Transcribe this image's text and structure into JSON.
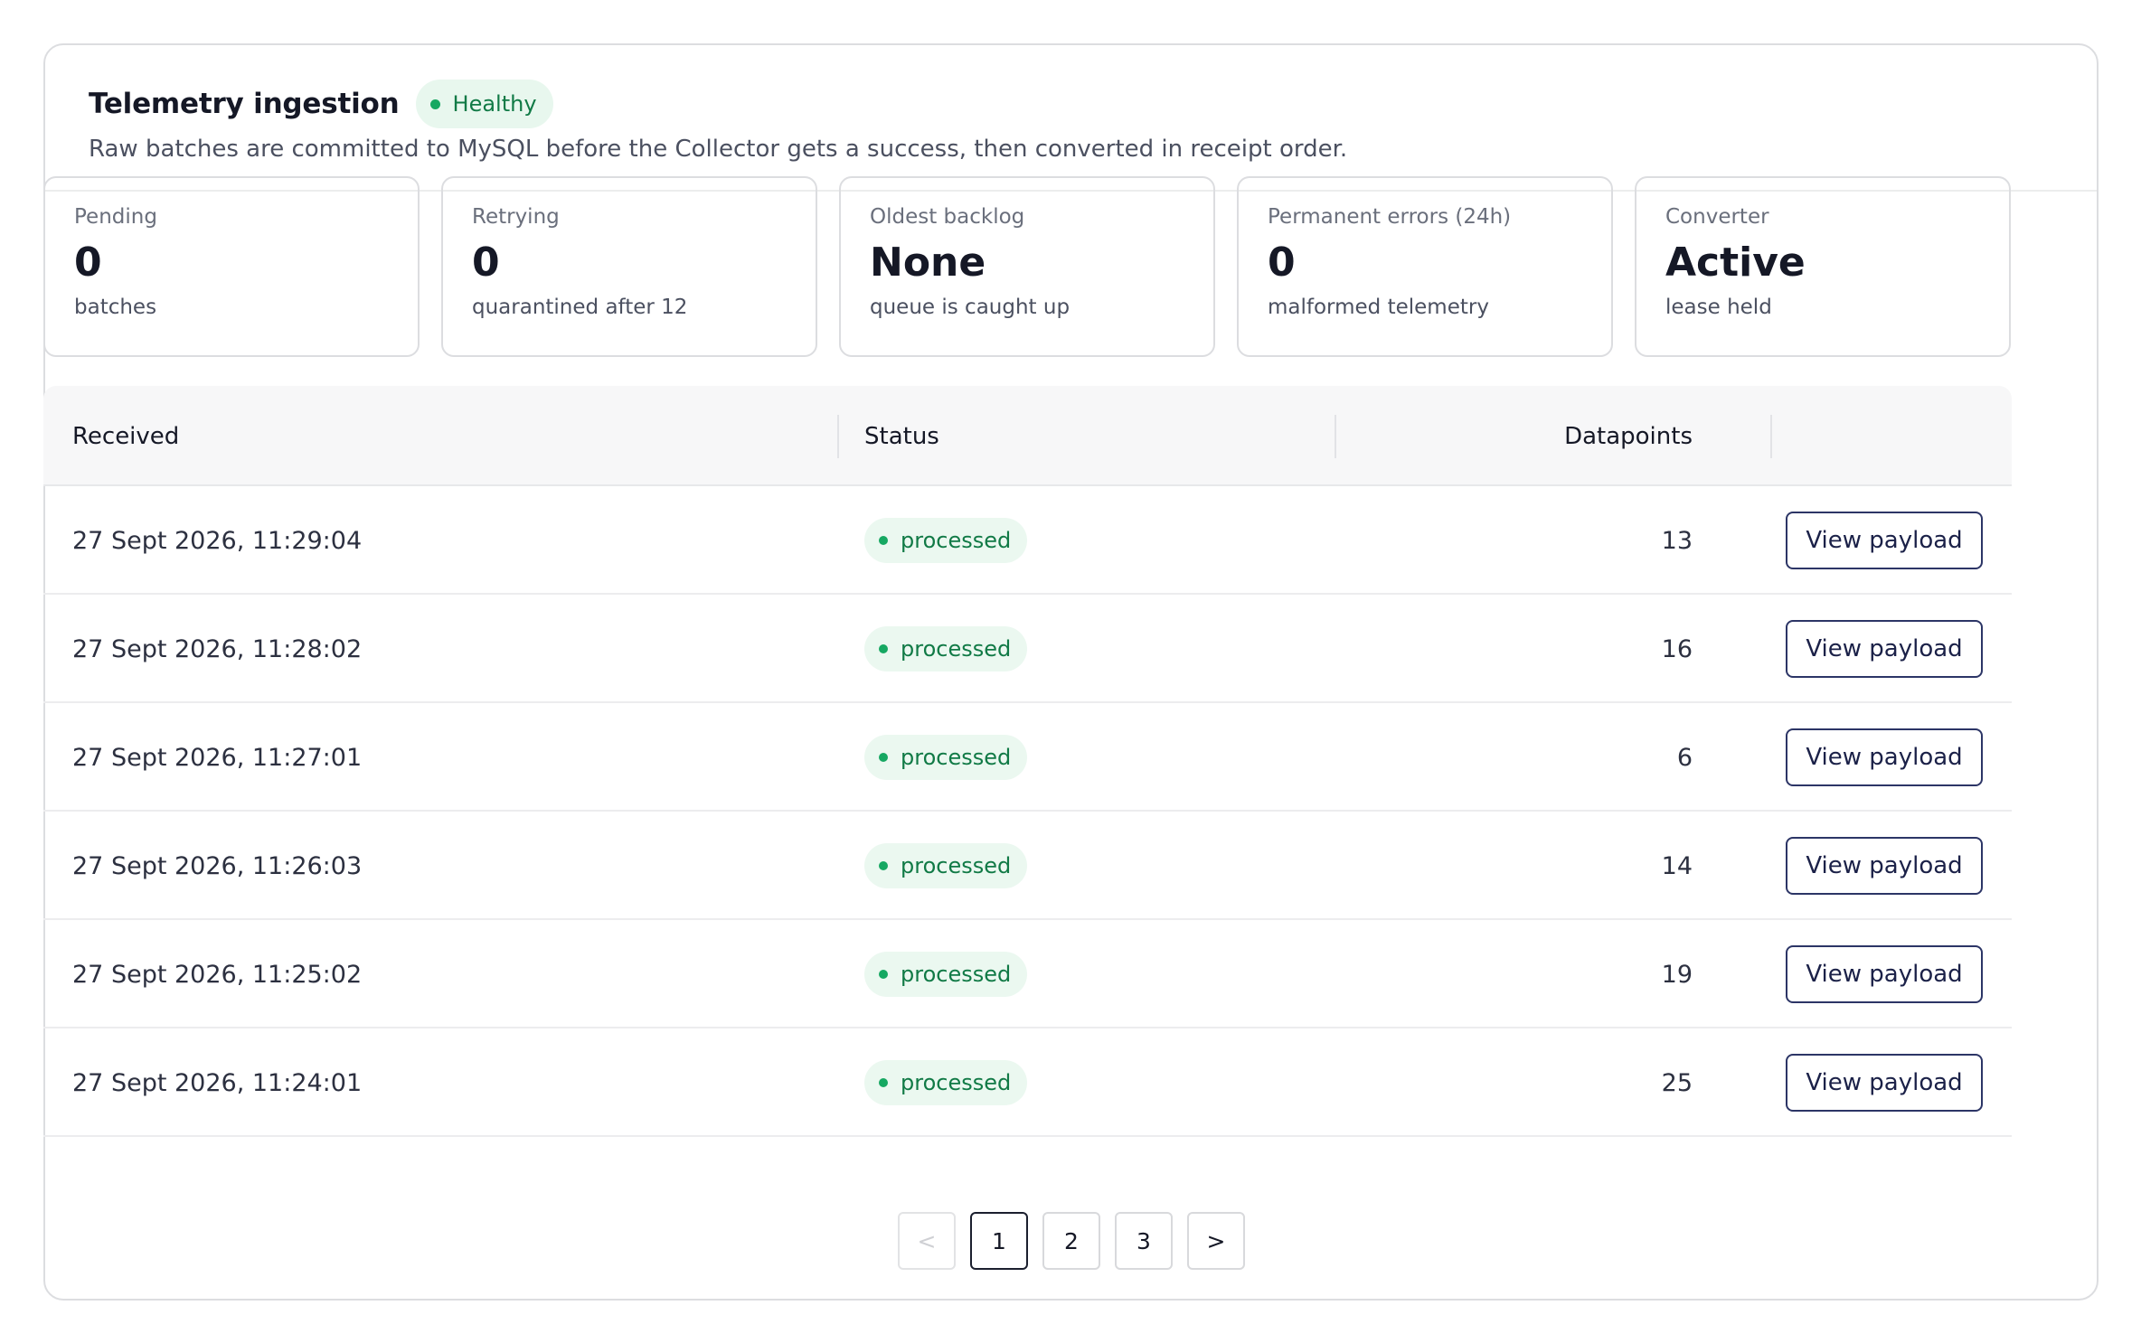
{
  "header": {
    "title": "Telemetry ingestion",
    "status_badge": "Healthy",
    "description": "Raw batches are committed to MySQL before the Collector gets a success, then converted in receipt order."
  },
  "stats": [
    {
      "label": "Pending",
      "value": "0",
      "sub": "batches"
    },
    {
      "label": "Retrying",
      "value": "0",
      "sub": "quarantined after 12"
    },
    {
      "label": "Oldest backlog",
      "value": "None",
      "sub": "queue is caught up"
    },
    {
      "label": "Permanent errors (24h)",
      "value": "0",
      "sub": "malformed telemetry"
    },
    {
      "label": "Converter",
      "value": "Active",
      "sub": "lease held"
    }
  ],
  "table": {
    "columns": [
      "Received",
      "Status",
      "Datapoints"
    ],
    "action_label": "View payload",
    "rows": [
      {
        "received": "27 Sept 2026, 11:29:04",
        "status": "processed",
        "datapoints": "13"
      },
      {
        "received": "27 Sept 2026, 11:28:02",
        "status": "processed",
        "datapoints": "16"
      },
      {
        "received": "27 Sept 2026, 11:27:01",
        "status": "processed",
        "datapoints": "6"
      },
      {
        "received": "27 Sept 2026, 11:26:03",
        "status": "processed",
        "datapoints": "14"
      },
      {
        "received": "27 Sept 2026, 11:25:02",
        "status": "processed",
        "datapoints": "19"
      },
      {
        "received": "27 Sept 2026, 11:24:01",
        "status": "processed",
        "datapoints": "25"
      }
    ]
  },
  "pagination": {
    "prev": "<",
    "pages": [
      "1",
      "2",
      "3"
    ],
    "next": ">",
    "current": "1"
  },
  "colors": {
    "accent_green": "#16a862",
    "button_border": "#2c3566"
  }
}
